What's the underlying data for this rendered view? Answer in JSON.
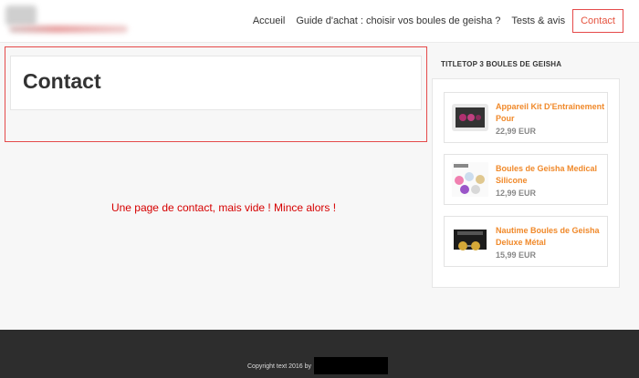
{
  "nav": {
    "items": [
      "Accueil",
      "Guide d'achat : choisir vos boules de geisha ?",
      "Tests & avis"
    ],
    "active": "Contact"
  },
  "page": {
    "title": "Contact",
    "message": "Une page de contact, mais vide ! Mince alors !"
  },
  "sidebar": {
    "title": "TITLETOP 3 BOULES DE GEISHA",
    "products": [
      {
        "name": "Appareil Kit D'Entraînement Pour",
        "price": "22,99 EUR"
      },
      {
        "name": "Boules de Geisha Medical Silicone",
        "price": "12,99 EUR"
      },
      {
        "name": "Nautime Boules de Geisha Deluxe Métal",
        "price": "15,99 EUR"
      }
    ]
  },
  "footer": {
    "copyright": "Copyright text 2016 by"
  },
  "colors": {
    "accent": "#e5533f",
    "product_link": "#f0892a",
    "message": "#d60000",
    "footer_bg": "#2d2d2d"
  }
}
